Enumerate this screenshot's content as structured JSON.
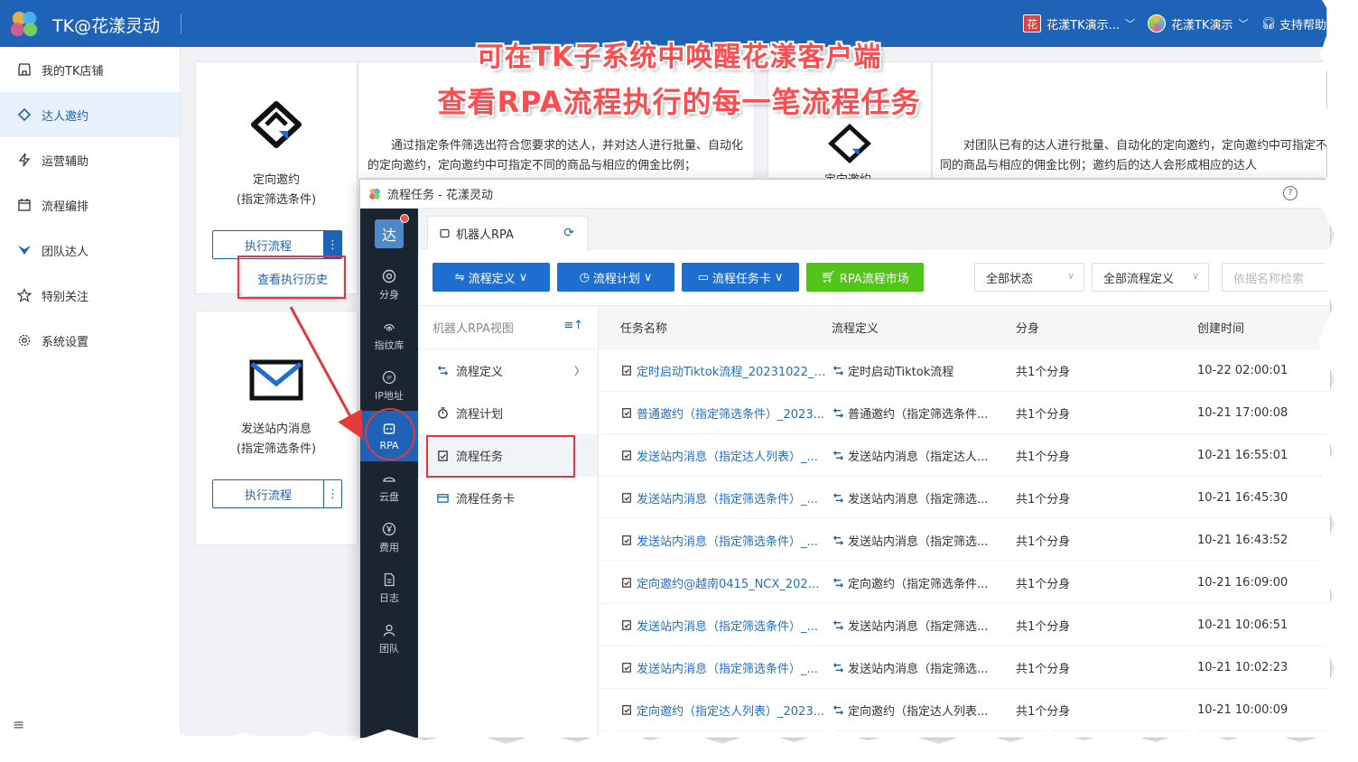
{
  "app": {
    "title": "TK@花漾灵动",
    "header": {
      "shop_badge": "花",
      "shop_name": "花漾TK演示...",
      "user_name": "花漾TK演示",
      "support": "支持帮助"
    },
    "sidebar": [
      {
        "label": "我的TK店铺",
        "icon": "store-icon"
      },
      {
        "label": "达人邀约",
        "icon": "handshake-icon",
        "active": true
      },
      {
        "label": "运营辅助",
        "icon": "lightning-icon"
      },
      {
        "label": "流程编排",
        "icon": "calendar-icon"
      },
      {
        "label": "团队达人",
        "icon": "team-icon"
      },
      {
        "label": "特别关注",
        "icon": "star-icon"
      },
      {
        "label": "系统设置",
        "icon": "gear-icon"
      }
    ],
    "cards": {
      "c1": {
        "name": "定向邀约",
        "sub": "(指定筛选条件)",
        "button": "执行流程",
        "more": "⋮"
      },
      "c2": {
        "name": "发送站内消息",
        "sub": "(指定筛选条件)",
        "button": "执行流程",
        "more": "⋮"
      }
    },
    "popup_history": "查看执行历史",
    "desc1": "通过指定条件筛选出符合您要求的达人，并对达人进行批量、自动化的定向邀约，定向邀约中可指定不同的商品与相应的佣金比例；",
    "desc2": "对团队已有的达人进行批量、自动化的定向邀约，定向邀约中可指定不同的商品与相应的佣金比例；邀约后的达人会形成相应的达人",
    "desc_card_peek": "定向邀约"
  },
  "headline": {
    "line1": "可在TK子系统中唤醒花漾客户端",
    "line2": "查看RPA流程执行的每一笔流程任务"
  },
  "client": {
    "window_title": "流程任务 - 花漾灵动",
    "rail": {
      "avatar": "达",
      "items": [
        {
          "label": "分身",
          "icon": "chrome-icon"
        },
        {
          "label": "指纹库",
          "icon": "fingerprint-icon"
        },
        {
          "label": "IP地址",
          "icon": "ip-icon"
        },
        {
          "label": "RPA",
          "icon": "robot-icon",
          "active": true
        },
        {
          "label": "云盘",
          "icon": "cloud-icon"
        },
        {
          "label": "费用",
          "icon": "yen-icon"
        },
        {
          "label": "日志",
          "icon": "log-icon"
        },
        {
          "label": "团队",
          "icon": "team-icon"
        }
      ]
    },
    "tab": "机器人RPA",
    "toolbar": {
      "btn_def": "流程定义",
      "btn_plan": "流程计划",
      "btn_card": "流程任务卡",
      "btn_market": "RPA流程市场",
      "sel_status": "全部状态",
      "sel_def": "全部流程定义",
      "search_placeholder": "依据名称检索"
    },
    "leftpane": {
      "title": "机器人RPA视图",
      "items": [
        {
          "label": "流程定义",
          "icon": "flow-icon"
        },
        {
          "label": "流程计划",
          "icon": "timer-icon"
        },
        {
          "label": "流程任务",
          "icon": "clipboard-icon",
          "active": true
        },
        {
          "label": "流程任务卡",
          "icon": "card-icon"
        }
      ]
    },
    "table": {
      "headers": [
        "任务名称",
        "流程定义",
        "分身",
        "创建时间"
      ],
      "rows": [
        {
          "name": "定时启动Tiktok流程_20231022_ui...",
          "def": "定时启动Tiktok流程",
          "profile": "共1个分身",
          "time": "10-22 02:00:01"
        },
        {
          "name": "普通邀约（指定筛选条件）_2023...",
          "def": "普通邀约（指定筛选条件...",
          "profile": "共1个分身",
          "time": "10-21 17:00:08"
        },
        {
          "name": "发送站内消息（指定达人列表）_...",
          "def": "发送站内消息（指定达人...",
          "profile": "共1个分身",
          "time": "10-21 16:55:01"
        },
        {
          "name": "发送站内消息（指定筛选条件）_...",
          "def": "发送站内消息（指定筛选...",
          "profile": "共1个分身",
          "time": "10-21 16:45:30"
        },
        {
          "name": "发送站内消息（指定筛选条件）_...",
          "def": "发送站内消息（指定筛选...",
          "profile": "共1个分身",
          "time": "10-21 16:43:52"
        },
        {
          "name": "定向邀约@越南0415_NCX_20231...",
          "def": "定向邀约（指定筛选条件...",
          "profile": "共1个分身",
          "time": "10-21 16:09:00"
        },
        {
          "name": "发送站内消息（指定筛选条件）_...",
          "def": "发送站内消息（指定筛选...",
          "profile": "共1个分身",
          "time": "10-21 10:06:51"
        },
        {
          "name": "发送站内消息（指定筛选条件）_...",
          "def": "发送站内消息（指定筛选...",
          "profile": "共1个分身",
          "time": "10-21 10:02:23"
        },
        {
          "name": "定向邀约（指定达人列表）_2023...",
          "def": "定向邀约（指定达人列表...",
          "profile": "共1个分身",
          "time": "10-21 10:00:09"
        }
      ]
    }
  },
  "colors": {
    "brand": "#1f63b8",
    "annotation": "#e23a3a",
    "green": "#52c41a"
  }
}
